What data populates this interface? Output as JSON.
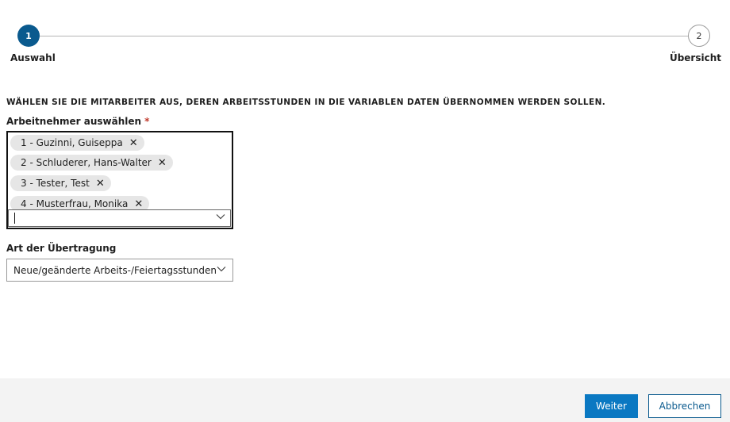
{
  "stepper": {
    "steps": [
      {
        "number": "1",
        "label": "Auswahl"
      },
      {
        "number": "2",
        "label": "Übersicht"
      }
    ]
  },
  "instruction": "WÄHLEN SIE DIE MITARBEITER AUS, DEREN ARBEITSSTUNDEN IN DIE VARIABLEN DATEN ÜBERNOMMEN WERDEN SOLLEN.",
  "employees_field": {
    "label": "Arbeitnehmer auswählen",
    "required_mark": "*",
    "selected": [
      "1 - Guzinni, Guiseppa",
      "2 - Schluderer, Hans-Walter",
      "3 - Tester, Test",
      "4 - Musterfrau, Monika"
    ],
    "remove_glyph": "✕",
    "input_value": ""
  },
  "transfer_field": {
    "label": "Art der Übertragung",
    "value": "Neue/geänderte Arbeits-/Feiertagsstunden"
  },
  "footer": {
    "next_label": "Weiter",
    "cancel_label": "Abbrechen"
  },
  "colors": {
    "accent": "#0a5a8e",
    "primary_button": "#0a78c2",
    "required": "#c0392b"
  }
}
